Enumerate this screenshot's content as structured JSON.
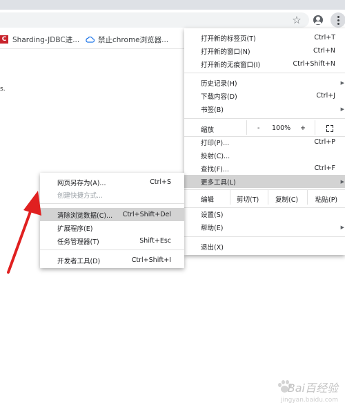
{
  "browser": {
    "bookmarks": [
      {
        "label": "Sharding-JDBC进...",
        "icon": "csdn-logo-icon",
        "logo_text": "C"
      },
      {
        "label": "禁止chrome浏览器...",
        "icon": "cloud-icon"
      }
    ],
    "page_fragment": "s."
  },
  "main_menu": {
    "new_tab": {
      "label": "打开新的标签页(T)",
      "shortcut": "Ctrl+T"
    },
    "new_window": {
      "label": "打开新的窗口(N)",
      "shortcut": "Ctrl+N"
    },
    "new_incognito": {
      "label": "打开新的无痕窗口(I)",
      "shortcut": "Ctrl+Shift+N"
    },
    "history": {
      "label": "历史记录(H)"
    },
    "downloads": {
      "label": "下载内容(D)",
      "shortcut": "Ctrl+J"
    },
    "bookmarks": {
      "label": "书签(B)"
    },
    "zoom": {
      "label": "缩放",
      "minus": "-",
      "value": "100%",
      "plus": "+"
    },
    "print": {
      "label": "打印(P)...",
      "shortcut": "Ctrl+P"
    },
    "cast": {
      "label": "投射(C)..."
    },
    "find": {
      "label": "查找(F)...",
      "shortcut": "Ctrl+F"
    },
    "more_tools": {
      "label": "更多工具(L)"
    },
    "edit": {
      "label": "编辑",
      "cut": "剪切(T)",
      "copy": "复制(C)",
      "paste": "粘贴(P)"
    },
    "settings": {
      "label": "设置(S)"
    },
    "help": {
      "label": "帮助(E)"
    },
    "exit": {
      "label": "退出(X)"
    }
  },
  "submenu": {
    "save_page": {
      "label": "网页另存为(A)...",
      "shortcut": "Ctrl+S"
    },
    "create_shortcut": {
      "label": "创建快捷方式..."
    },
    "clear_data": {
      "label": "清除浏览数据(C)...",
      "shortcut": "Ctrl+Shift+Del"
    },
    "extensions": {
      "label": "扩展程序(E)"
    },
    "task_manager": {
      "label": "任务管理器(T)",
      "shortcut": "Shift+Esc"
    },
    "dev_tools": {
      "label": "开发者工具(D)",
      "shortcut": "Ctrl+Shift+I"
    }
  },
  "watermark": {
    "main": "Bai百经验",
    "sub": "jingyan.baidu.com"
  },
  "colors": {
    "highlight": "#d3d3d3",
    "annotation_arrow": "#e02020",
    "menu_bg": "#ffffff",
    "tab_strip": "#dee1e6"
  },
  "icons": [
    "star-icon",
    "profile-icon",
    "menu-kebab-icon",
    "csdn-logo-icon",
    "cloud-icon",
    "submenu-arrow-icon",
    "fullscreen-icon"
  ]
}
